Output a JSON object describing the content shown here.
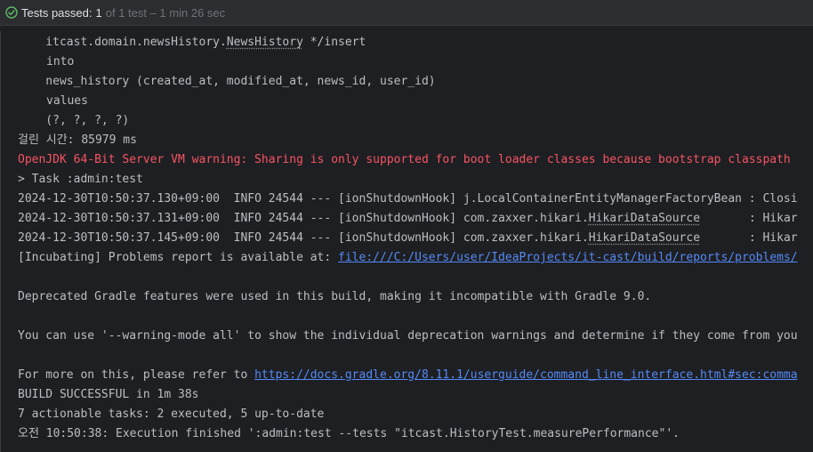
{
  "status": {
    "label": "Tests passed:",
    "count": "1",
    "detail": "of 1 test – 1 min 26 sec",
    "icon": "check-circle-icon",
    "accent": "#5fb865"
  },
  "console": {
    "sql_entity_prefix": "    itcast.domain.newsHistory.",
    "sql_entity_class": "NewsHistory",
    "sql_entity_suffix": " */insert",
    "sql_into": "into",
    "sql_table": "    news_history (created_at, modified_at, news_id, user_id)",
    "sql_values": "values",
    "sql_params": "    (?, ?, ?, ?)",
    "elapsed": "걸린 시간: 85979 ms",
    "jvm_warning": "OpenJDK 64-Bit Server VM warning: Sharing is only supported for boot loader classes because bootstrap classpath",
    "task": "> Task :admin:test",
    "log1": "2024-12-30T10:50:37.130+09:00  INFO 24544 --- [ionShutdownHook] j.LocalContainerEntityManagerFactoryBean : Closi",
    "log2_prefix": "2024-12-30T10:50:37.131+09:00  INFO 24544 --- [ionShutdownHook] com.zaxxer.hikari.",
    "log2_class": "HikariDataSource",
    "log2_suffix": "       : Hikar",
    "log3_prefix": "2024-12-30T10:50:37.145+09:00  INFO 24544 --- [ionShutdownHook] com.zaxxer.hikari.",
    "log3_class": "HikariDataSource",
    "log3_suffix": "       : Hikar",
    "problems_text": "[Incubating] Problems report is available at: ",
    "problems_link": "file:///C:/Users/user/IdeaProjects/it-cast/build/reports/problems/",
    "deprecated": "Deprecated Gradle features were used in this build, making it incompatible with Gradle 9.0.",
    "warning_mode": "You can use '--warning-mode all' to show the individual deprecation warnings and determine if they come from you",
    "more_info_text": "For more on this, please refer to ",
    "more_info_link": "https://docs.gradle.org/8.11.1/userguide/command_line_interface.html#sec:comma",
    "build_result": "BUILD SUCCESSFUL in 1m 38s",
    "tasks_summary": "7 actionable tasks: 2 executed, 5 up-to-date",
    "finished": "오전 10:50:38: Execution finished ':admin:test --tests \"itcast.HistoryTest.measurePerformance\"'."
  }
}
